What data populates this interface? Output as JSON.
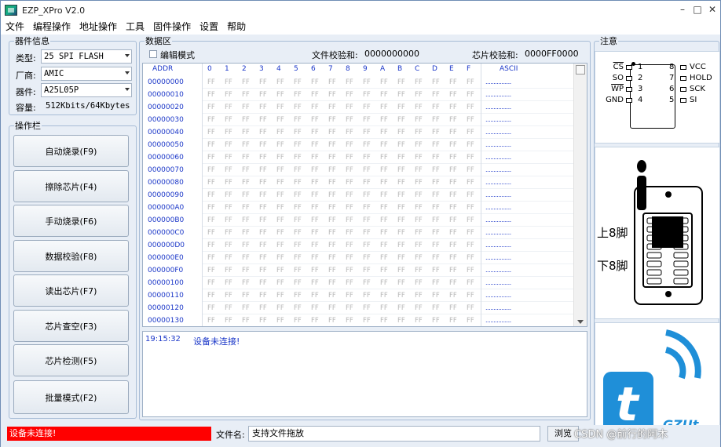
{
  "window": {
    "title": "EZP_XPro V2.0"
  },
  "menu": [
    "文件",
    "编程操作",
    "地址操作",
    "工具",
    "固件操作",
    "设置",
    "帮助"
  ],
  "device": {
    "legend": "器件信息",
    "type_label": "类型:",
    "type_value": "25 SPI FLASH",
    "vendor_label": "厂商:",
    "vendor_value": "AMIC",
    "chip_label": "器件:",
    "chip_value": "A25L05P",
    "capacity_label": "容量:",
    "capacity_value": "512Kbits/64Kbytes"
  },
  "ops": {
    "legend": "操作栏",
    "buttons": [
      "自动烧录(F9)",
      "擦除芯片(F4)",
      "手动烧录(F6)",
      "数据校验(F8)",
      "读出芯片(F7)",
      "芯片查空(F3)",
      "芯片检测(F5)",
      "批量模式(F2)"
    ]
  },
  "data": {
    "legend": "数据区",
    "edit_mode": "编辑模式",
    "file_checksum_label": "文件校验和:",
    "file_checksum_value": "0000000000",
    "chip_checksum_label": "芯片校验和:",
    "chip_checksum_value": "0000FF0000",
    "header_addr": "ADDR",
    "header_cols": [
      "0",
      "1",
      "2",
      "3",
      "4",
      "5",
      "6",
      "7",
      "8",
      "9",
      "A",
      "B",
      "C",
      "D",
      "E",
      "F"
    ],
    "header_ascii": "ASCII",
    "addresses": [
      "00000000",
      "00000010",
      "00000020",
      "00000030",
      "00000040",
      "00000050",
      "00000060",
      "00000070",
      "00000080",
      "00000090",
      "000000A0",
      "000000B0",
      "000000C0",
      "000000D0",
      "000000E0",
      "000000F0",
      "00000100",
      "00000110",
      "00000120",
      "00000130"
    ],
    "byte": "FF",
    "ascii_row": "................"
  },
  "log": {
    "time": "19:15:32",
    "message": "设备未连接!"
  },
  "note": {
    "legend": "注意",
    "pins_left": [
      {
        "name": "CS",
        "num": "1"
      },
      {
        "name": "SO",
        "num": "2"
      },
      {
        "name": "WP",
        "num": "3"
      },
      {
        "name": "GND",
        "num": "4"
      }
    ],
    "pins_right": [
      {
        "num": "8",
        "name": "VCC"
      },
      {
        "num": "7",
        "name": "HOLD"
      },
      {
        "num": "6",
        "name": "SCK"
      },
      {
        "num": "5",
        "name": "SI"
      }
    ],
    "upper_pins": "上8脚",
    "lower_pins": "下8脚",
    "brand": "GZUt"
  },
  "status": {
    "connection": "设备未连接!",
    "filename_label": "文件名:",
    "filename_value": "支持文件拖放",
    "browse": "浏览",
    "watermark": "CSDN @前行的阿木"
  },
  "colors": {
    "status_red": "#ff0000",
    "address_blue": "#1a36c8",
    "brand_blue": "#1f8fd8"
  }
}
